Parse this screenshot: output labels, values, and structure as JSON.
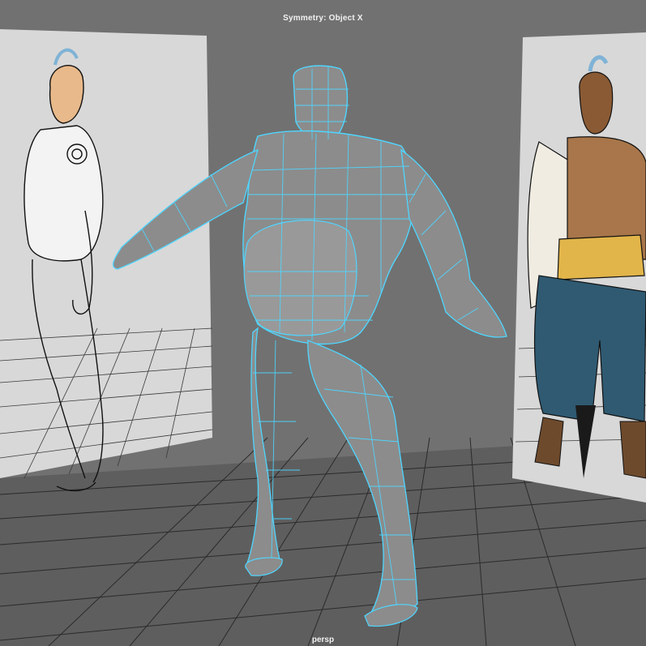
{
  "viewport": {
    "symmetry_label": "Symmetry: Object X",
    "camera_label": "persp"
  },
  "scene": {
    "mesh_wire_color": "#4fd6ff",
    "mesh_fill_color": "#8a8a8a",
    "grid_line_color": "#2a2a2a",
    "ground_color": "#5a5a5a",
    "plane_color": "#d6d6d6"
  }
}
